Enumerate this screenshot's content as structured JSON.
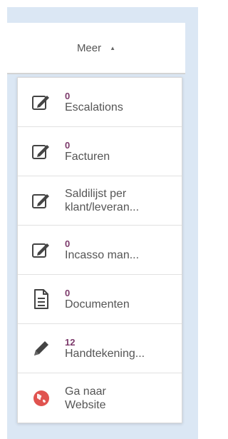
{
  "header": {
    "more_label": "Meer",
    "more_caret": "▲"
  },
  "menu": [
    {
      "icon": "edit-icon",
      "count": "0",
      "label": "Escalations"
    },
    {
      "icon": "edit-icon",
      "count": "0",
      "label": "Facturen"
    },
    {
      "icon": "edit-icon",
      "count": "",
      "label_line1": "Saldilijst per",
      "label_line2": "klant/leveran..."
    },
    {
      "icon": "edit-icon",
      "count": "0",
      "label": "Incasso man..."
    },
    {
      "icon": "document-icon",
      "count": "0",
      "label": "Documenten"
    },
    {
      "icon": "pencil-icon",
      "count": "12",
      "label": "Handtekening..."
    },
    {
      "icon": "globe-icon",
      "count": "",
      "label_line1": "Ga naar",
      "label_line2": "Website"
    }
  ],
  "colors": {
    "count": "#7c3a6b",
    "globe": "#e0534f",
    "backdrop": "#dbe7f4"
  }
}
